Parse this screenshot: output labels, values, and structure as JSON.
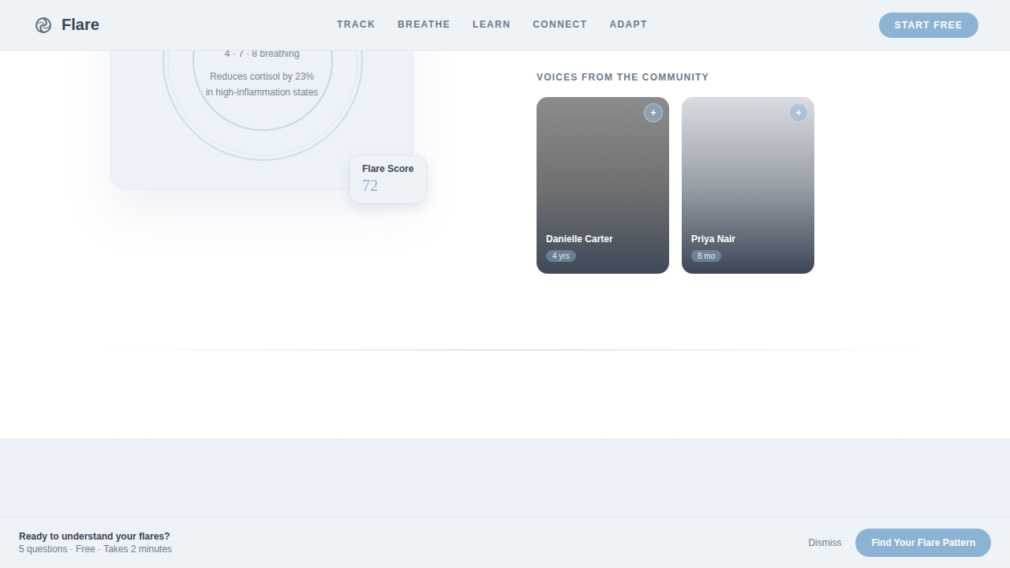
{
  "header": {
    "logo": "Flare",
    "nav": [
      "TRACK",
      "BREATHE",
      "LEARN",
      "CONNECT",
      "ADAPT"
    ],
    "cta": "START FREE"
  },
  "breathing_card": {
    "title": "4 · 7 · 8 breathing",
    "lines": [
      "Reduces cortisol by 23%",
      "in high-inflammation states"
    ]
  },
  "score_badge": {
    "label": "Flare Score",
    "value": "72"
  },
  "community": {
    "title": "VOICES FROM THE COMMUNITY",
    "members": [
      {
        "name": "Danielle Carter",
        "tenure": "4 yrs",
        "action": "+"
      },
      {
        "name": "Priya Nair",
        "tenure": "8 mo",
        "action": "+"
      }
    ]
  },
  "cta_bar": {
    "title": "Ready to understand your flares?",
    "subtitle": "5 questions · Free · Takes 2 minutes",
    "dismiss": "Dismiss",
    "button": "Find Your Flare Pattern"
  }
}
